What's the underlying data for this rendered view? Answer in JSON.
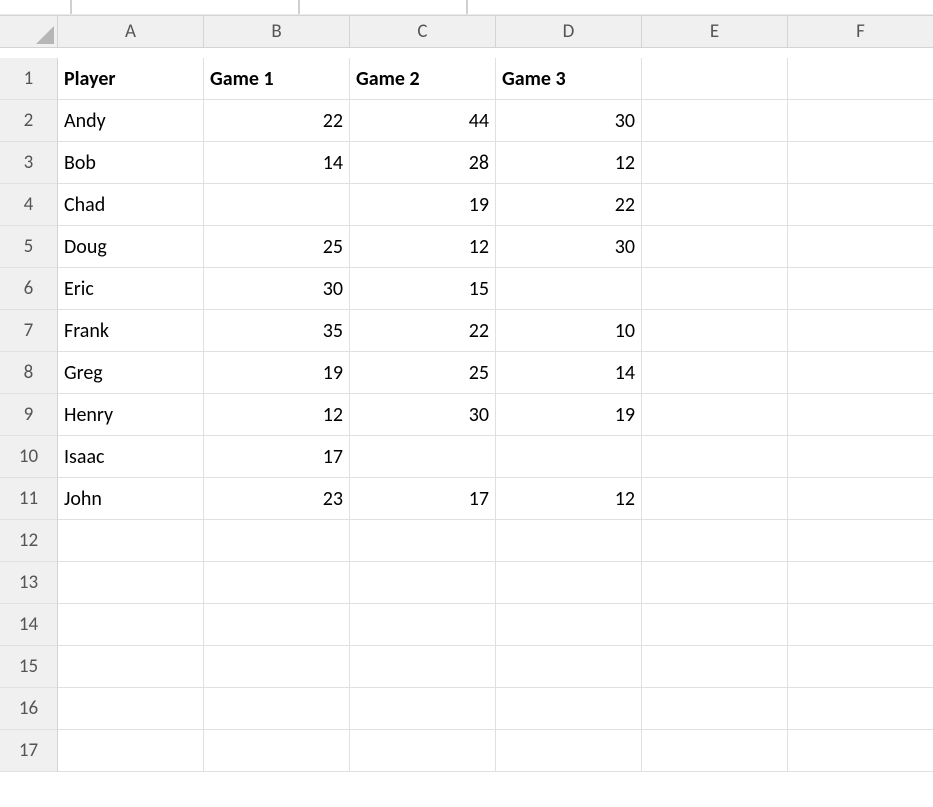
{
  "columns": [
    "A",
    "B",
    "C",
    "D",
    "E",
    "F"
  ],
  "rowCount": 17,
  "headers": {
    "A": "Player",
    "B": "Game 1",
    "C": "Game 2",
    "D": "Game 3"
  },
  "data": [
    {
      "player": "Andy",
      "g1": 22,
      "g2": 44,
      "g3": 30
    },
    {
      "player": "Bob",
      "g1": 14,
      "g2": 28,
      "g3": 12
    },
    {
      "player": "Chad",
      "g1": null,
      "g2": 19,
      "g3": 22
    },
    {
      "player": "Doug",
      "g1": 25,
      "g2": 12,
      "g3": 30
    },
    {
      "player": "Eric",
      "g1": 30,
      "g2": 15,
      "g3": null
    },
    {
      "player": "Frank",
      "g1": 35,
      "g2": 22,
      "g3": 10
    },
    {
      "player": "Greg",
      "g1": 19,
      "g2": 25,
      "g3": 14
    },
    {
      "player": "Henry",
      "g1": 12,
      "g2": 30,
      "g3": 19
    },
    {
      "player": "Isaac",
      "g1": 17,
      "g2": null,
      "g3": null
    },
    {
      "player": "John",
      "g1": 23,
      "g2": 17,
      "g3": 12
    }
  ],
  "chart_data": {
    "type": "table",
    "title": "",
    "columns": [
      "Player",
      "Game 1",
      "Game 2",
      "Game 3"
    ],
    "rows": [
      [
        "Andy",
        22,
        44,
        30
      ],
      [
        "Bob",
        14,
        28,
        12
      ],
      [
        "Chad",
        null,
        19,
        22
      ],
      [
        "Doug",
        25,
        12,
        30
      ],
      [
        "Eric",
        30,
        15,
        null
      ],
      [
        "Frank",
        35,
        22,
        10
      ],
      [
        "Greg",
        19,
        25,
        14
      ],
      [
        "Henry",
        12,
        30,
        19
      ],
      [
        "Isaac",
        17,
        null,
        null
      ],
      [
        "John",
        23,
        17,
        12
      ]
    ]
  }
}
